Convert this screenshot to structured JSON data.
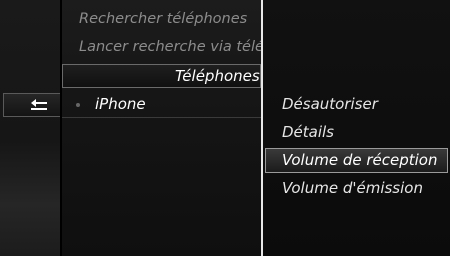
{
  "list": {
    "items": [
      {
        "label": "Rechercher téléphones"
      },
      {
        "label": "Lancer recherche via téléphone"
      }
    ],
    "header": "Téléphones",
    "selected_device": "iPhone"
  },
  "submenu": {
    "items": [
      {
        "label": "Désautoriser"
      },
      {
        "label": "Détails"
      },
      {
        "label": "Volume de réception",
        "selected": true
      },
      {
        "label": "Volume d'émission"
      }
    ]
  },
  "icons": {
    "back": "back-arrow-icon"
  },
  "colors": {
    "text": "#e6e6e6",
    "dim_text": "#8c8c8c",
    "highlight_border": "#9a9a9a"
  }
}
